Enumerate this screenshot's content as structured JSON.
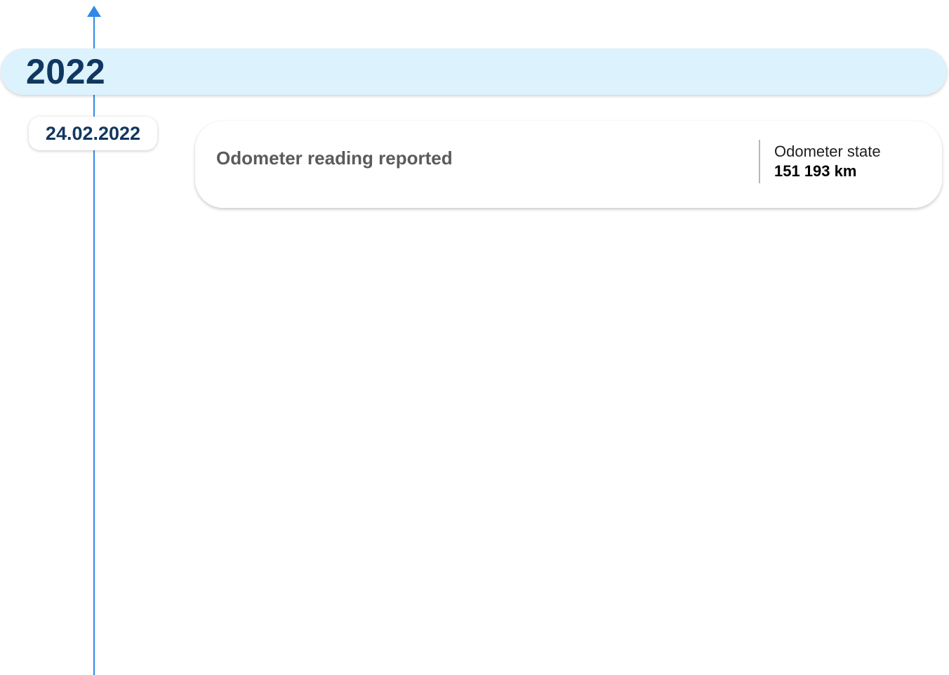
{
  "timeline": {
    "accent_color": "#2e8ae6"
  },
  "year_header": {
    "year": "2022",
    "background_color": "#dcf2fd",
    "text_color": "#10375f"
  },
  "events": [
    {
      "date": "24.02.2022",
      "title": "Odometer reading reported",
      "meta_label": "Odometer state",
      "meta_value": "151 193 km"
    }
  ]
}
